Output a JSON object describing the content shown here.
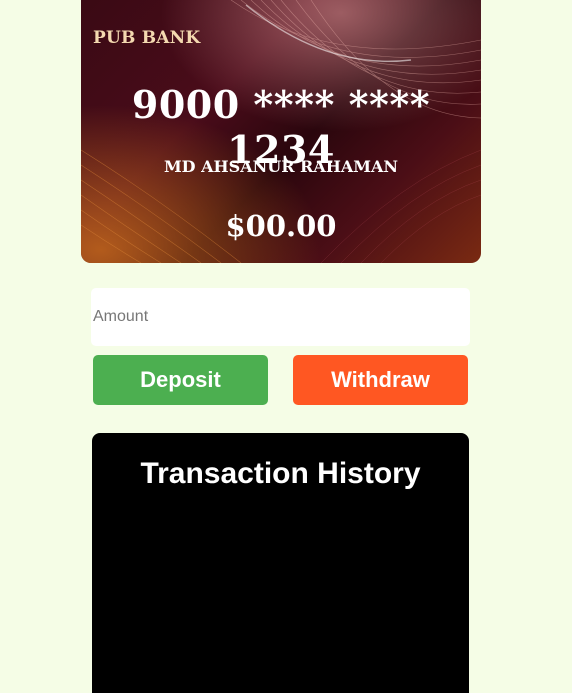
{
  "card": {
    "bank_name": "PUB BANK",
    "number": "9000 **** **** 1234",
    "holder_name": "MD AHSANUR RAHAMAN",
    "balance": "$00.00"
  },
  "form": {
    "amount_placeholder": "Amount",
    "amount_value": "",
    "deposit_label": "Deposit",
    "withdraw_label": "Withdraw"
  },
  "history": {
    "title": "Transaction History"
  },
  "colors": {
    "page_background": "#f5fde6",
    "deposit_button": "#4caf50",
    "withdraw_button": "#ff5722",
    "history_panel": "#000000",
    "bank_name_text": "#f4d9b0"
  }
}
